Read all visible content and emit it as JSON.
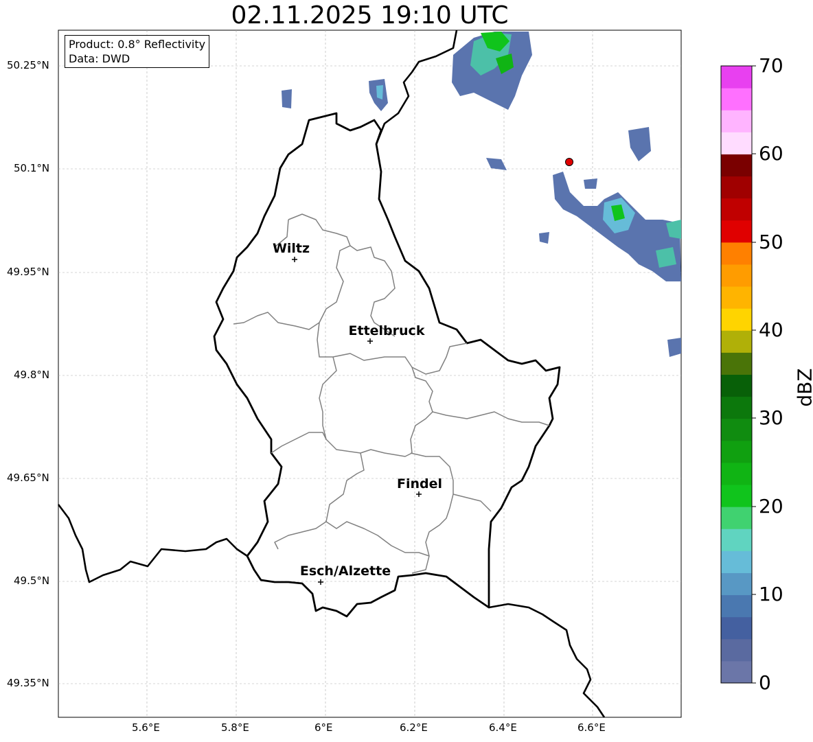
{
  "title": "02.11.2025 19:10 UTC",
  "info": {
    "product": "Product: 0.8° Reflectivity",
    "data_source": "Data: DWD"
  },
  "map": {
    "lat_ticks": [
      "50.25°N",
      "50.1°N",
      "49.95°N",
      "49.8°N",
      "49.65°N",
      "49.5°N",
      "49.35°N"
    ],
    "lon_ticks": [
      "5.6°E",
      "5.8°E",
      "6°E",
      "6.2°E",
      "6.4°E",
      "6.6°E"
    ],
    "cities": [
      {
        "name": "Wiltz"
      },
      {
        "name": "Ettelbruck"
      },
      {
        "name": "Findel"
      },
      {
        "name": "Esch/Alzette"
      }
    ],
    "grid": true,
    "marker_color": "#e00000"
  },
  "colorbar": {
    "label": "dBZ",
    "min": 0,
    "max": 70,
    "ticks": [
      "0",
      "10",
      "20",
      "30",
      "40",
      "50",
      "60",
      "70"
    ],
    "colors": [
      "#6b76a8",
      "#5a6aa0",
      "#4460a0",
      "#4a78b0",
      "#5898c4",
      "#66bcd8",
      "#60d4c0",
      "#40d270",
      "#10c41c",
      "#10b414",
      "#10a010",
      "#108c10",
      "#0c780c",
      "#086008",
      "#4a7408",
      "#b0b008",
      "#ffd400",
      "#ffb400",
      "#ff9c00",
      "#ff8000",
      "#e00000",
      "#c00000",
      "#a00000",
      "#7a0000",
      "#ffdcff",
      "#ffb4ff",
      "#ff70ff",
      "#e840f0"
    ]
  }
}
